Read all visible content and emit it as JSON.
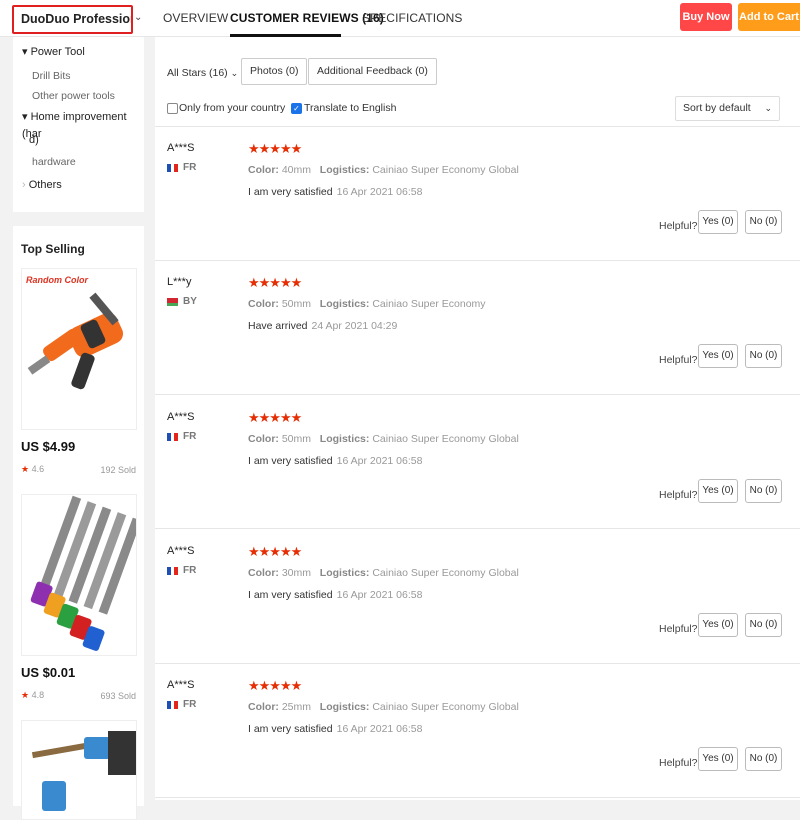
{
  "header": {
    "store_name": "DuoDuo Profession...",
    "tabs": [
      {
        "label": "OVERVIEW"
      },
      {
        "label": "CUSTOMER REVIEWS (16)"
      },
      {
        "label": "SPECIFICATIONS"
      }
    ],
    "buy_now": "Buy Now",
    "add_to_cart": "Add to Cart",
    "colors": {
      "buy": "#ff4747",
      "cart": "#ff9c1a",
      "highlight_box": "#e02020"
    }
  },
  "categories": {
    "power_tool": "Power Tool",
    "drill_bits": "Drill Bits",
    "other_power_tools": "Other power tools",
    "home_improvement": "Home improvement (har",
    "home_improvement_cont": "d)",
    "hardware": "hardware",
    "others": "Others"
  },
  "top_selling": {
    "title": "Top Selling",
    "products": [
      {
        "badge": "Random Color",
        "price": "US $4.99",
        "rating": "4.6",
        "sold": "192 Sold"
      },
      {
        "price": "US $0.01",
        "rating": "4.8",
        "sold": "693 Sold"
      },
      {}
    ]
  },
  "filters": {
    "all_stars": "All Stars (16)",
    "photos": "Photos (0)",
    "additional": "Additional Feedback (0)",
    "only_country": "Only from your country",
    "translate": "Translate to English",
    "sort": "Sort by default"
  },
  "review_labels": {
    "color": "Color:",
    "logistics": "Logistics:",
    "helpful": "Helpful?"
  },
  "reviews": [
    {
      "name": "A***S",
      "country": "FR",
      "stars": "★★★★★",
      "color": "40mm",
      "logistics": "Cainiao Super Economy Global",
      "text": "I am very satisfied",
      "date": "16 Apr 2021 06:58",
      "yes": "Yes (0)",
      "no": "No (0)"
    },
    {
      "name": "L***y",
      "country": "BY",
      "stars": "★★★★★",
      "color": "50mm",
      "logistics": "Cainiao Super Economy",
      "text": "Have arrived",
      "date": "24 Apr 2021 04:29",
      "yes": "Yes (0)",
      "no": "No (0)"
    },
    {
      "name": "A***S",
      "country": "FR",
      "stars": "★★★★★",
      "color": "50mm",
      "logistics": "Cainiao Super Economy Global",
      "text": "I am very satisfied",
      "date": "16 Apr 2021 06:58",
      "yes": "Yes (0)",
      "no": "No (0)"
    },
    {
      "name": "A***S",
      "country": "FR",
      "stars": "★★★★★",
      "color": "30mm",
      "logistics": "Cainiao Super Economy Global",
      "text": "I am very satisfied",
      "date": "16 Apr 2021 06:58",
      "yes": "Yes (0)",
      "no": "No (0)"
    },
    {
      "name": "A***S",
      "country": "FR",
      "stars": "★★★★★",
      "color": "25mm",
      "logistics": "Cainiao Super Economy Global",
      "text": "I am very satisfied",
      "date": "16 Apr 2021 06:58",
      "yes": "Yes (0)",
      "no": "No (0)"
    }
  ]
}
